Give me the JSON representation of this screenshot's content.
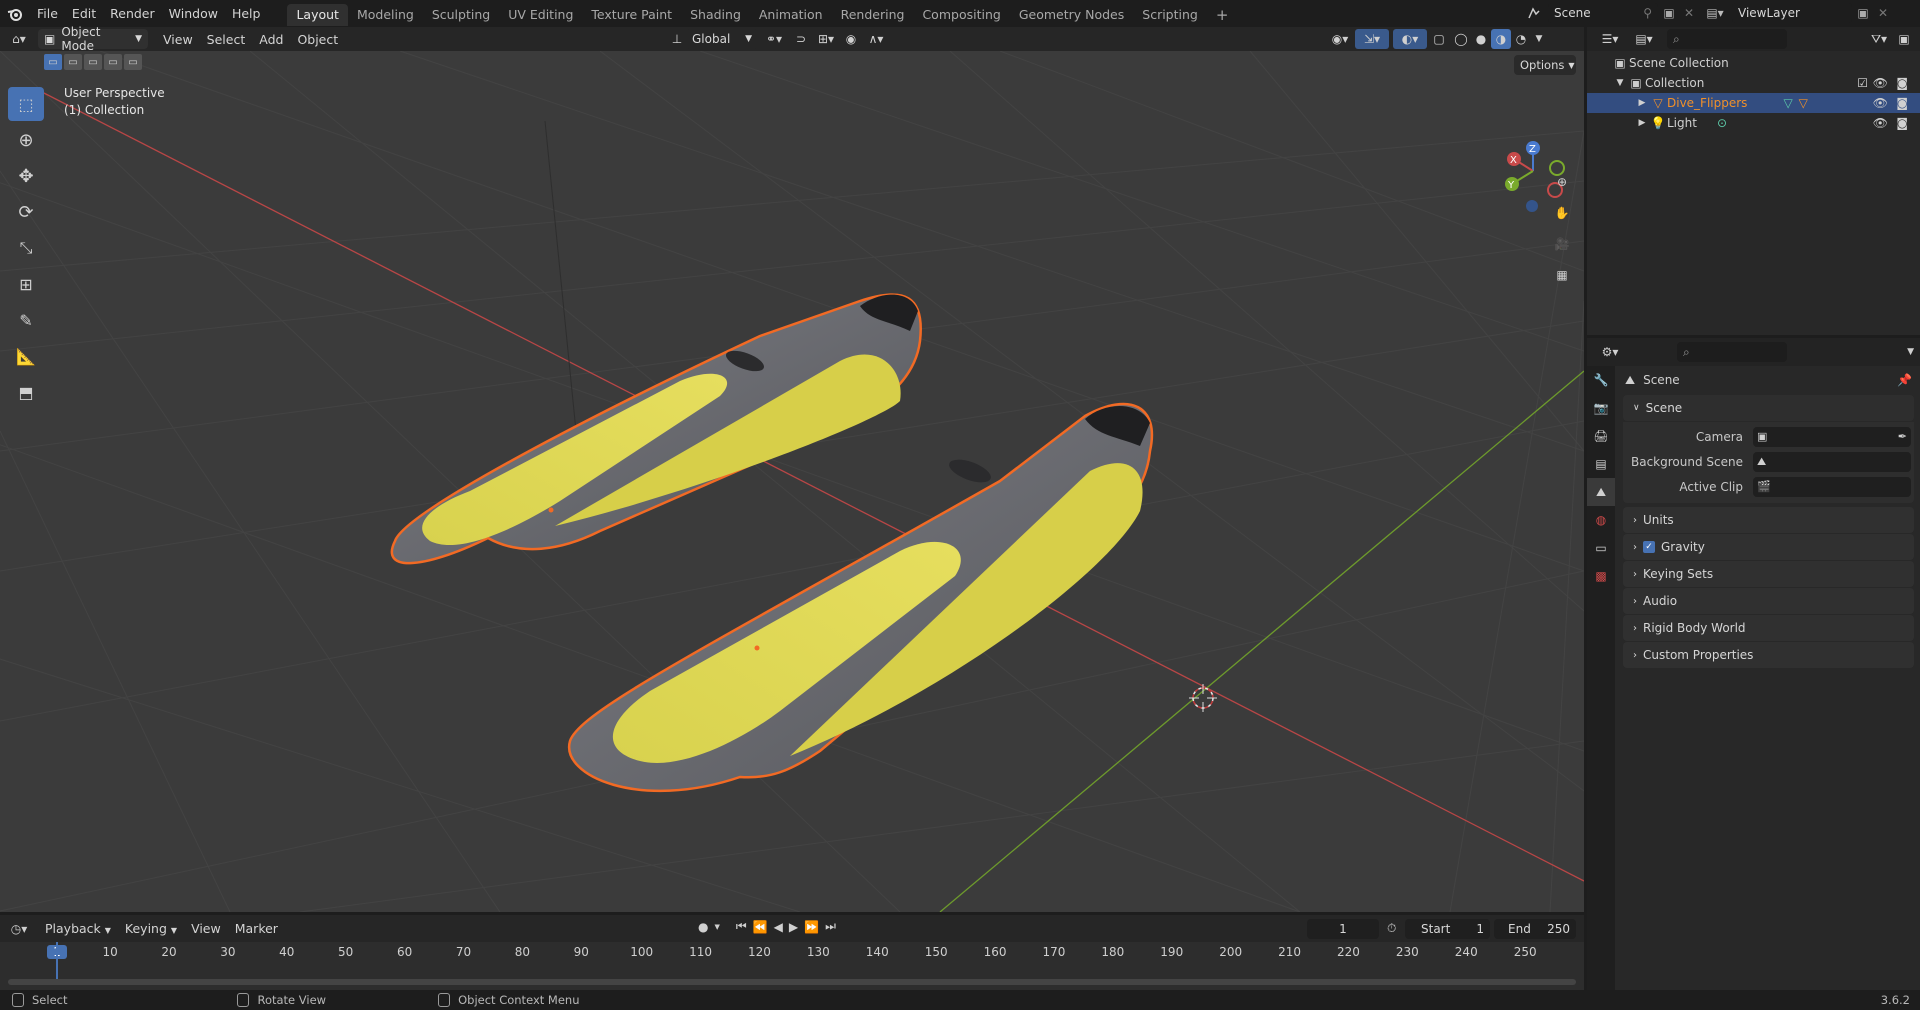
{
  "topbar": {
    "menus": [
      "File",
      "Edit",
      "Render",
      "Window",
      "Help"
    ],
    "workspaces": [
      "Layout",
      "Modeling",
      "Sculpting",
      "UV Editing",
      "Texture Paint",
      "Shading",
      "Animation",
      "Rendering",
      "Compositing",
      "Geometry Nodes",
      "Scripting"
    ],
    "active_workspace": "Layout",
    "add_tab": "+",
    "scene_name": "Scene",
    "view_layer": "ViewLayer"
  },
  "viewport_header": {
    "mode": "Object Mode",
    "menus": [
      "View",
      "Select",
      "Add",
      "Object"
    ],
    "transform_orientation": "Global",
    "options_label": "Options"
  },
  "viewport": {
    "perspective_label": "User Perspective",
    "collection_label": "(1) Collection",
    "colors": {
      "background": "#3b3b3b",
      "fin_yellow": "#d9d350",
      "fin_gray": "#6e6f74",
      "selection": "#f0702a",
      "x_axis": "#c24848",
      "y_axis": "#6f9a2a"
    }
  },
  "tools": [
    "select-box-icon",
    "cursor-icon",
    "move-icon",
    "rotate-icon",
    "scale-icon",
    "transform-icon",
    "annotate-icon",
    "measure-icon",
    "add-cube-icon"
  ],
  "outliner": {
    "scene_collection": "Scene Collection",
    "collection": "Collection",
    "items": [
      {
        "name": "Dive_Flippers",
        "selected": true
      },
      {
        "name": "Light",
        "selected": false
      }
    ]
  },
  "properties": {
    "context_title": "Scene",
    "scene_panel": "Scene",
    "fields": [
      {
        "label": "Camera"
      },
      {
        "label": "Background Scene"
      },
      {
        "label": "Active Clip"
      }
    ],
    "panels": [
      "Units",
      "Gravity",
      "Keying Sets",
      "Audio",
      "Rigid Body World",
      "Custom Properties"
    ],
    "gravity_enabled": true
  },
  "timeline": {
    "menus": [
      "Playback",
      "Keying",
      "View",
      "Marker"
    ],
    "current_frame": "1",
    "start_label": "Start",
    "start": "1",
    "end_label": "End",
    "end": "250",
    "ticks": [
      "1",
      "10",
      "20",
      "30",
      "40",
      "50",
      "60",
      "70",
      "80",
      "90",
      "100",
      "110",
      "120",
      "130",
      "140",
      "150",
      "160",
      "170",
      "180",
      "190",
      "200",
      "210",
      "220",
      "230",
      "240",
      "250"
    ]
  },
  "status": {
    "select": "Select",
    "rotate": "Rotate View",
    "context": "Object Context Menu",
    "version": "3.6.2"
  }
}
